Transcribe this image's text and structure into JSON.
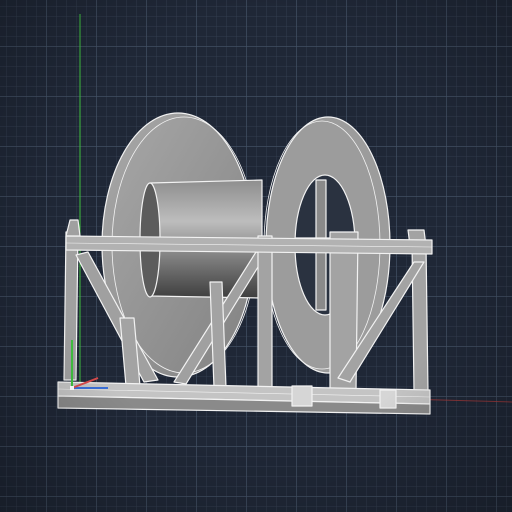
{
  "viewport": {
    "background_color": "#1f2736",
    "grid_color": "#465468",
    "axis_x_color": "#b03a3a",
    "axis_y_color": "#3fbf3f",
    "ucs_icon": "ucs-axis-icon"
  },
  "model": {
    "object": "cable-reel-on-frame",
    "surface_color": "#9a9a9a",
    "edge_color": "#f2f2f2",
    "drum_highlight": "#bdbdbd",
    "drum_shadow": "#4a4a4a"
  }
}
